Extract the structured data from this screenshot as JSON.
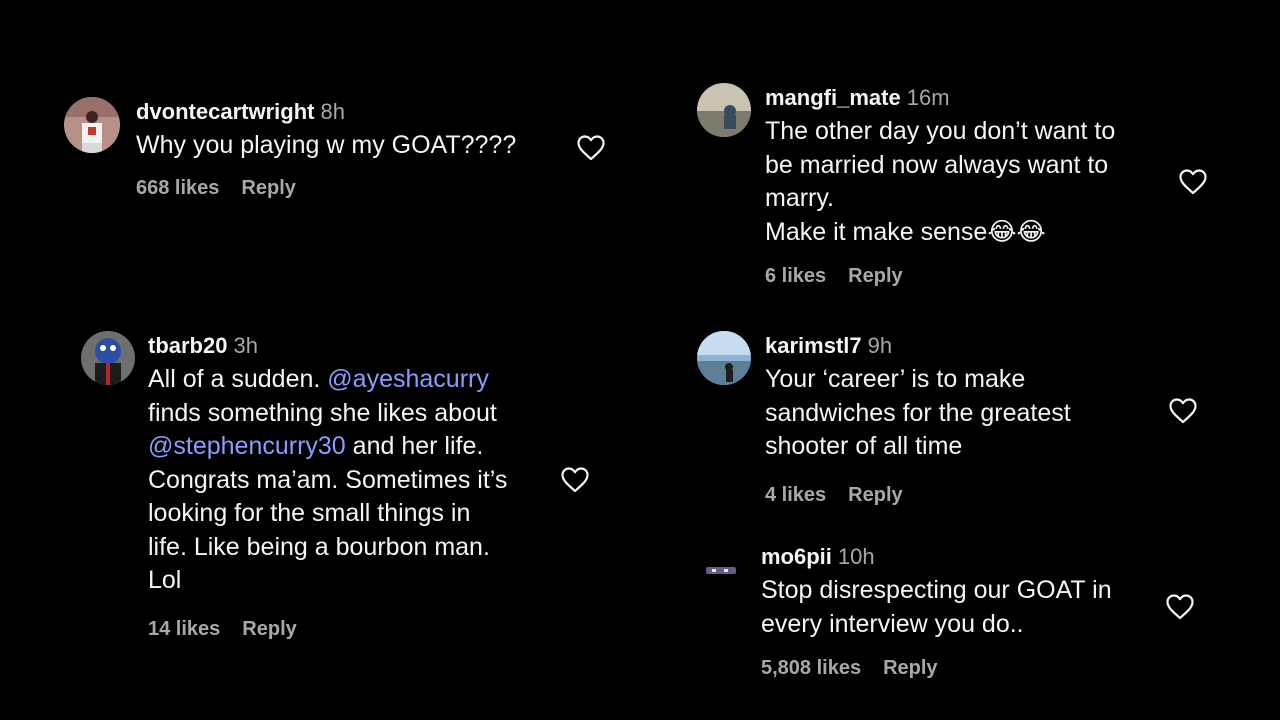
{
  "colors": {
    "background": "#000000",
    "text": "#f5f5f5",
    "muted": "#a8a8a8",
    "mention": "#8d9bff"
  },
  "icons": {
    "like": "heart-outline-icon"
  },
  "comments": [
    {
      "username": "dvontecartwright",
      "time": "8h",
      "lines": [
        "Why you playing w my GOAT????"
      ],
      "likes": "668 likes",
      "reply": "Reply"
    },
    {
      "username": "tbarb20",
      "time": "3h",
      "lines": [
        "All of a sudden. ",
        "@ayeshacurry",
        "finds something she likes about",
        "@stephencurry30",
        " and her life.",
        "Congrats ma’am. Sometimes it’s",
        "looking for the small things in",
        "life. Like being a bourbon man.",
        "Lol"
      ],
      "likes": "14 likes",
      "reply": "Reply"
    },
    {
      "username": "mangfi_mate",
      "time": "16m",
      "lines": [
        "The other day you don’t want to",
        "be married now always want to",
        "marry.",
        "Make it make sense😂😂"
      ],
      "likes": "6 likes",
      "reply": "Reply"
    },
    {
      "username": "karimstl7",
      "time": "9h",
      "lines": [
        "Your ‘career’ is to make",
        "sandwiches for the greatest",
        "shooter of all time"
      ],
      "likes": "4 likes",
      "reply": "Reply"
    },
    {
      "username": "mo6pii",
      "time": "10h",
      "lines": [
        "Stop disrespecting our GOAT in",
        "every interview you do.."
      ],
      "likes": "5,808 likes",
      "reply": "Reply"
    }
  ]
}
